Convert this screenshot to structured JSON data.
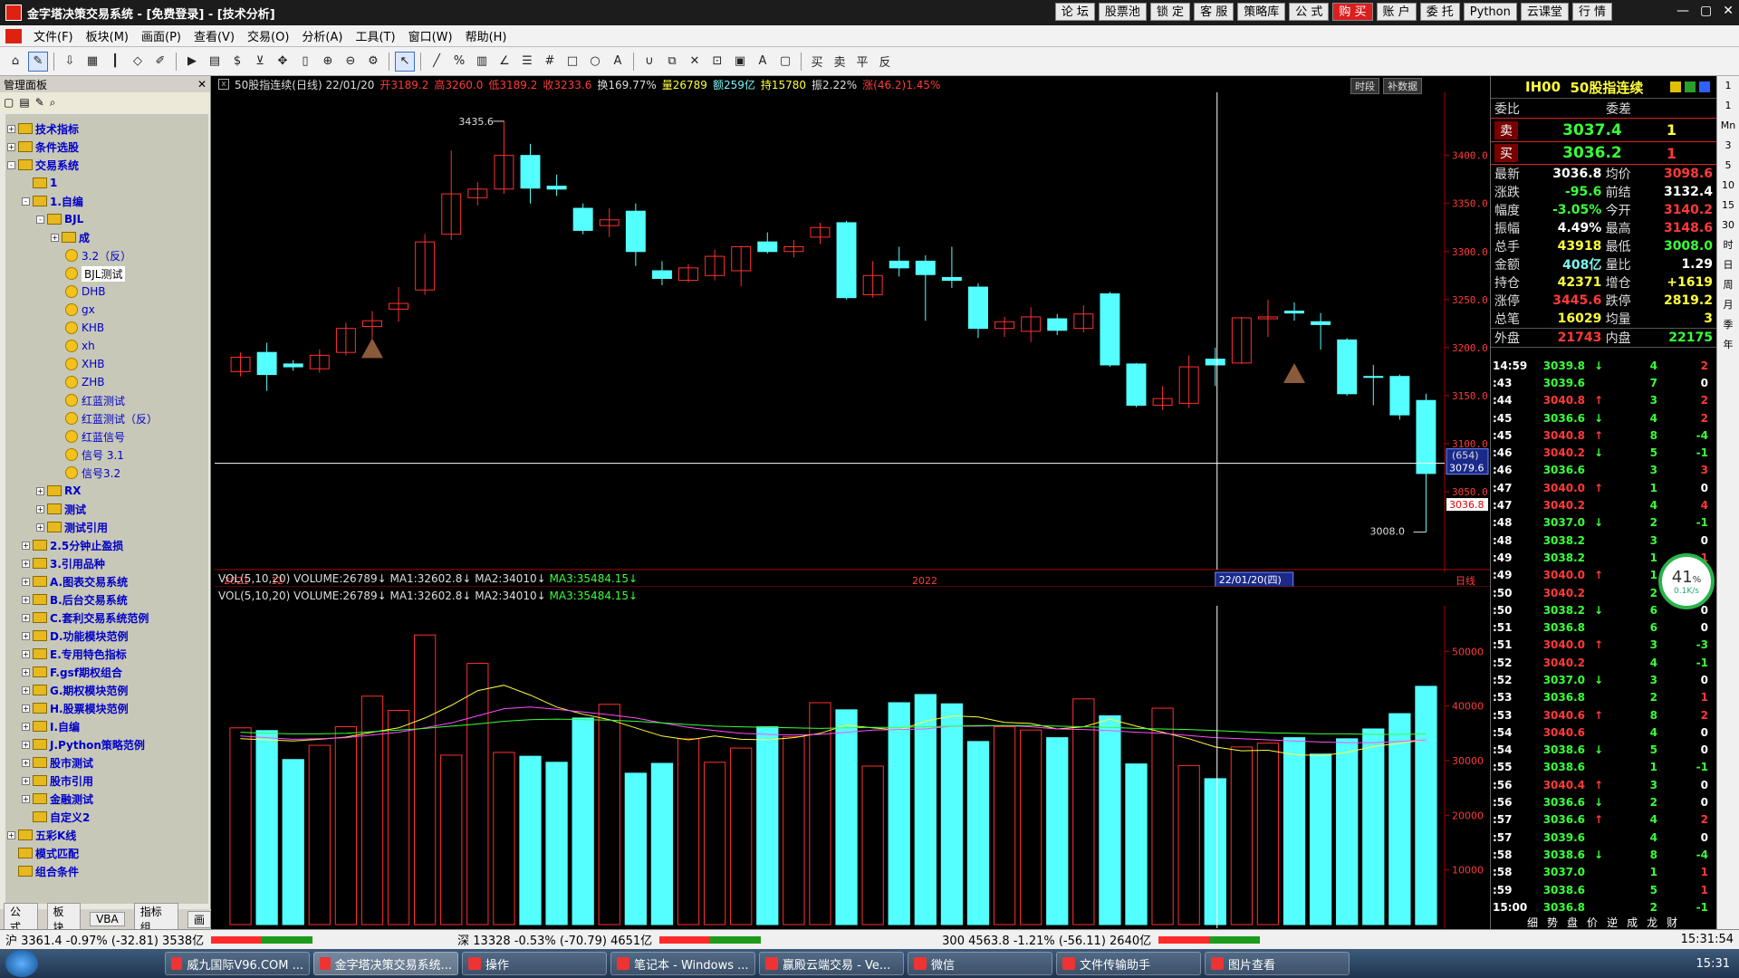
{
  "window": {
    "title": "金字塔决策交易系统 - [免费登录] - [技术分析]",
    "topbuttons": [
      "论 坛",
      "股票池",
      "锁 定",
      "客 服",
      "策略库",
      "公 式",
      "购 买",
      "账 户",
      "委 托",
      "Python",
      "云课堂",
      "行 情"
    ],
    "controls": [
      "—",
      "▢",
      "✕"
    ]
  },
  "menu": [
    "文件(F)",
    "板块(M)",
    "画面(P)",
    "查看(V)",
    "交易(O)",
    "分析(A)",
    "工具(T)",
    "窗口(W)",
    "帮助(H)"
  ],
  "toolbar_icons": [
    "home-icon",
    "draw-icon",
    "download-icon",
    "grid-icon",
    "bars-icon",
    "diamond-icon",
    "edit-icon",
    "play-icon",
    "doc-icon",
    "dollar-icon",
    "filter-icon",
    "cross-icon",
    "ruler-icon",
    "zoom-in-icon",
    "zoom-out-icon",
    "gear-icon",
    "pointer-icon",
    "line-icon",
    "percent-icon",
    "table-icon",
    "angle-icon",
    "hbars-icon",
    "hash-icon",
    "rect-icon",
    "circle-icon",
    "text-icon",
    "magnet-icon",
    "copy-icon",
    "delete-icon",
    "lock-icon",
    "lock2-icon",
    "font-icon",
    "save-icon",
    "buy-icon",
    "sell-icon",
    "flat-icon",
    "reverse-icon"
  ],
  "sidebar": {
    "title": "管理面板",
    "tree": [
      {
        "level": 0,
        "type": "fold",
        "exp": "+",
        "label": "技术指标"
      },
      {
        "level": 0,
        "type": "fold",
        "exp": "+",
        "label": "条件选股"
      },
      {
        "level": 0,
        "type": "fold",
        "exp": "-",
        "label": "交易系统"
      },
      {
        "level": 1,
        "type": "fold",
        "exp": "",
        "label": "1"
      },
      {
        "level": 1,
        "type": "fold",
        "exp": "-",
        "label": "1.自编"
      },
      {
        "level": 2,
        "type": "fold",
        "exp": "-",
        "label": "BJL"
      },
      {
        "level": 3,
        "type": "fold",
        "exp": "+",
        "label": "成"
      },
      {
        "level": 4,
        "type": "smile",
        "label": "3.2（反）"
      },
      {
        "level": 4,
        "type": "smile",
        "label": "BJL测试",
        "hl": true
      },
      {
        "level": 4,
        "type": "smile",
        "label": "DHB"
      },
      {
        "level": 4,
        "type": "smile",
        "label": "gx"
      },
      {
        "level": 4,
        "type": "smile",
        "label": "KHB"
      },
      {
        "level": 4,
        "type": "smile",
        "label": "xh"
      },
      {
        "level": 4,
        "type": "smile",
        "label": "XHB"
      },
      {
        "level": 4,
        "type": "smile",
        "label": "ZHB"
      },
      {
        "level": 4,
        "type": "smile",
        "label": "红蓝测试"
      },
      {
        "level": 4,
        "type": "smile",
        "label": "红蓝测试（反）"
      },
      {
        "level": 4,
        "type": "smile",
        "label": "红蓝信号"
      },
      {
        "level": 4,
        "type": "smile",
        "label": "信号 3.1"
      },
      {
        "level": 4,
        "type": "smile",
        "label": "信号3.2"
      },
      {
        "level": 2,
        "type": "fold",
        "exp": "+",
        "label": "RX"
      },
      {
        "level": 2,
        "type": "fold",
        "exp": "+",
        "label": "测试"
      },
      {
        "level": 2,
        "type": "fold",
        "exp": "+",
        "label": "测试引用"
      },
      {
        "level": 1,
        "type": "fold",
        "exp": "+",
        "label": "2.5分钟止盈损"
      },
      {
        "level": 1,
        "type": "fold",
        "exp": "+",
        "label": "3.引用品种"
      },
      {
        "level": 1,
        "type": "fold",
        "exp": "+",
        "label": "A.图表交易系统"
      },
      {
        "level": 1,
        "type": "fold",
        "exp": "+",
        "label": "B.后台交易系统"
      },
      {
        "level": 1,
        "type": "fold",
        "exp": "+",
        "label": "C.套利交易系统范例"
      },
      {
        "level": 1,
        "type": "fold",
        "exp": "+",
        "label": "D.功能模块范例"
      },
      {
        "level": 1,
        "type": "fold",
        "exp": "+",
        "label": "E.专用特色指标"
      },
      {
        "level": 1,
        "type": "fold",
        "exp": "+",
        "label": "F.gsf期权组合"
      },
      {
        "level": 1,
        "type": "fold",
        "exp": "+",
        "label": "G.期权模块范例"
      },
      {
        "level": 1,
        "type": "fold",
        "exp": "+",
        "label": "H.股票模块范例"
      },
      {
        "level": 1,
        "type": "fold",
        "exp": "+",
        "label": "I.自编"
      },
      {
        "level": 1,
        "type": "fold",
        "exp": "+",
        "label": "J.Python策略范例"
      },
      {
        "level": 1,
        "type": "fold",
        "exp": "+",
        "label": "股市测试"
      },
      {
        "level": 1,
        "type": "fold",
        "exp": "+",
        "label": "股市引用"
      },
      {
        "level": 1,
        "type": "fold",
        "exp": "+",
        "label": "金融测试"
      },
      {
        "level": 1,
        "type": "fold",
        "exp": "",
        "label": "自定义2"
      },
      {
        "level": 0,
        "type": "fold",
        "exp": "+",
        "label": "五彩K线"
      },
      {
        "level": 0,
        "type": "fold",
        "exp": "",
        "label": "模式匹配"
      },
      {
        "level": 0,
        "type": "fold",
        "exp": "",
        "label": "组合条件"
      }
    ],
    "tabs": [
      "公式",
      "板块",
      "VBA",
      "指标组",
      "画"
    ]
  },
  "chart": {
    "header": {
      "name": "50股指连续(日线) 22/01/20",
      "open": "开3189.2",
      "high": "高3260.0",
      "low": "低3189.2",
      "close": "收3233.6",
      "turnover": "换169.77%",
      "vol": "量26789",
      "amount": "额259亿",
      "oi": "持15780",
      "amp": "振2.22%",
      "chg": "涨(46.2)1.45%",
      "btn1": "时段",
      "btn2": "补数据"
    },
    "vol_header": {
      "name": "VOL(5,10,20)",
      "volume": "VOLUME:26789",
      "ma1": "MA1:32602.8",
      "ma2": "MA2:34010",
      "ma3": "MA3:35484.15"
    },
    "crosshair": {
      "date_label": "22/01/20(四)",
      "price_label": "3079.6",
      "badge": "(654)",
      "last": "3036.8"
    },
    "x_labels": [
      "2021",
      "12",
      "2022",
      "日线"
    ],
    "annotations": {
      "high": "3435.6",
      "low": "3008.0"
    }
  },
  "chart_data": [
    {
      "type": "candlestick",
      "ylim": [
        2985,
        3460
      ],
      "yticks": [
        3050,
        3100,
        3150,
        3200,
        3250,
        3300,
        3350,
        3400
      ],
      "candles": [
        [
          3175,
          3190,
          3170,
          3195
        ],
        [
          3195,
          3172,
          3155,
          3205
        ],
        [
          3183,
          3180,
          3176,
          3187
        ],
        [
          3178,
          3192,
          3174,
          3198
        ],
        [
          3195,
          3220,
          3192,
          3226
        ],
        [
          3222,
          3228,
          3210,
          3238
        ],
        [
          3240,
          3246,
          3227,
          3263
        ],
        [
          3260,
          3310,
          3255,
          3318
        ],
        [
          3318,
          3360,
          3312,
          3405
        ],
        [
          3356,
          3365,
          3348,
          3372
        ],
        [
          3365,
          3400,
          3360,
          3436
        ],
        [
          3400,
          3366,
          3350,
          3412
        ],
        [
          3368,
          3365,
          3358,
          3380
        ],
        [
          3345,
          3322,
          3318,
          3350
        ],
        [
          3327,
          3333,
          3315,
          3345
        ],
        [
          3342,
          3300,
          3285,
          3350
        ],
        [
          3280,
          3272,
          3265,
          3290
        ],
        [
          3270,
          3283,
          3268,
          3287
        ],
        [
          3275,
          3295,
          3270,
          3302
        ],
        [
          3280,
          3305,
          3264,
          3306
        ],
        [
          3310,
          3300,
          3298,
          3320
        ],
        [
          3300,
          3305,
          3294,
          3312
        ],
        [
          3315,
          3325,
          3308,
          3330
        ],
        [
          3330,
          3252,
          3250,
          3332
        ],
        [
          3255,
          3275,
          3252,
          3290
        ],
        [
          3290,
          3283,
          3274,
          3305
        ],
        [
          3290,
          3276,
          3228,
          3296
        ],
        [
          3273,
          3270,
          3262,
          3305
        ],
        [
          3263,
          3220,
          3210,
          3267
        ],
        [
          3220,
          3227,
          3211,
          3232
        ],
        [
          3217,
          3232,
          3206,
          3242
        ],
        [
          3230,
          3218,
          3213,
          3235
        ],
        [
          3220,
          3235,
          3216,
          3244
        ],
        [
          3256,
          3182,
          3180,
          3258
        ],
        [
          3183,
          3140,
          3138,
          3184
        ],
        [
          3140,
          3147,
          3135,
          3160
        ],
        [
          3142,
          3180,
          3137,
          3192
        ],
        [
          3188,
          3182,
          3160,
          3200
        ],
        [
          3184,
          3231,
          3183,
          3232
        ],
        [
          3230,
          3232,
          3211,
          3250
        ],
        [
          3238,
          3236,
          3228,
          3247
        ],
        [
          3227,
          3224,
          3198,
          3236
        ],
        [
          3208,
          3152,
          3150,
          3210
        ],
        [
          3170,
          3169,
          3140,
          3182
        ],
        [
          3170,
          3130,
          3125,
          3172
        ],
        [
          3145,
          3069,
          3008,
          3152
        ]
      ]
    },
    {
      "type": "bar",
      "name": "VOL(5,10,20)",
      "ylim": [
        0,
        58000
      ],
      "yticks": [
        10000,
        20000,
        30000,
        40000,
        50000
      ],
      "values": [
        36000,
        35500,
        30200,
        32800,
        36200,
        41800,
        39200,
        53000,
        31000,
        47800,
        31500,
        30800,
        29700,
        37800,
        40300,
        27700,
        29500,
        34000,
        29700,
        32300,
        36200,
        34400,
        40600,
        39300,
        29000,
        40600,
        42100,
        40400,
        33500,
        36200,
        35600,
        34200,
        41300,
        38200,
        29400,
        39600,
        29100,
        26700,
        32500,
        33200,
        34200,
        31200,
        34000,
        35800,
        38600,
        43600
      ],
      "ma": [
        {
          "name": "MA1",
          "color": "#ffff3a",
          "values": [
            34000,
            33800,
            33600,
            33900,
            34300,
            35200,
            36000,
            37800,
            40100,
            42800,
            43800,
            42000,
            39800,
            38500,
            37500,
            36000,
            34500,
            33800,
            34500,
            33900,
            33800,
            34200,
            35000,
            36500,
            36000,
            35600,
            37200,
            38200,
            38000,
            37000,
            36800,
            35800,
            36200,
            37600,
            36300,
            35200,
            34000,
            32500,
            31800,
            31900,
            31100,
            30900,
            31500,
            32600,
            33200,
            33800
          ]
        },
        {
          "name": "MA2",
          "color": "#ff4cff",
          "values": [
            34500,
            34200,
            33900,
            34000,
            34200,
            34700,
            35200,
            36000,
            36900,
            38200,
            39500,
            39800,
            39400,
            38900,
            38400,
            37800,
            36900,
            36100,
            35500,
            35000,
            34800,
            34700,
            34800,
            35200,
            35600,
            35700,
            35800,
            36300,
            36300,
            36400,
            36200,
            35800,
            35700,
            35500,
            35200,
            35000,
            34600,
            34200,
            34000,
            33800,
            33600,
            33400,
            33300,
            33300,
            33500,
            33800
          ]
        },
        {
          "name": "MA3",
          "color": "#3aff3a",
          "values": [
            35200,
            35000,
            34900,
            34900,
            35000,
            35300,
            35600,
            35900,
            36300,
            36700,
            37200,
            37500,
            37600,
            37500,
            37400,
            37200,
            36900,
            36600,
            36300,
            36200,
            36100,
            36000,
            35900,
            36000,
            36100,
            36100,
            36200,
            36300,
            36400,
            36400,
            36400,
            36300,
            36200,
            36100,
            35900,
            35800,
            35700,
            35500,
            35300,
            35100,
            35000,
            34900,
            34900,
            34800,
            34800,
            34900
          ]
        }
      ]
    }
  ],
  "quote": {
    "code": "IH00",
    "name": "50股指连续",
    "webi": "委比",
    "weicha": "委差",
    "sell": {
      "label": "卖",
      "price": "3037.4",
      "qty": "1"
    },
    "buy": {
      "label": "买",
      "price": "3036.2",
      "qty": "1"
    },
    "rows": [
      [
        "最新",
        "3036.8",
        "均价",
        "3098.6"
      ],
      [
        "涨跌",
        "-95.6",
        "前结",
        "3132.4"
      ],
      [
        "幅度",
        "-3.05%",
        "今开",
        "3140.2"
      ],
      [
        "振幅",
        "4.49%",
        "最高",
        "3148.6"
      ],
      [
        "总手",
        "43918",
        "最低",
        "3008.0"
      ],
      [
        "金额",
        "408亿",
        "量比",
        "1.29"
      ],
      [
        "持仓",
        "42371",
        "增仓",
        "+1619"
      ],
      [
        "涨停",
        "3445.6",
        "跌停",
        "2819.2"
      ],
      [
        "总笔",
        "16029",
        "均量",
        "3"
      ]
    ],
    "outer": [
      "外盘",
      "21743",
      "内盘",
      "22175"
    ],
    "ticks": [
      [
        "14:59",
        "3039.8",
        "↓",
        "4",
        "2"
      ],
      [
        ":43",
        "3039.6",
        "",
        "7",
        "0"
      ],
      [
        ":44",
        "3040.8",
        "↑",
        "3",
        "2"
      ],
      [
        ":45",
        "3036.6",
        "↓",
        "4",
        "2"
      ],
      [
        ":45",
        "3040.8",
        "↑",
        "8",
        "-4"
      ],
      [
        ":46",
        "3040.2",
        "↓",
        "5",
        "-1"
      ],
      [
        ":46",
        "3036.6",
        "",
        "3",
        "3"
      ],
      [
        ":47",
        "3040.0",
        "↑",
        "1",
        "0"
      ],
      [
        ":47",
        "3040.2",
        "",
        "4",
        "4"
      ],
      [
        ":48",
        "3037.0",
        "↓",
        "2",
        "-1"
      ],
      [
        ":48",
        "3038.2",
        "",
        "3",
        "0"
      ],
      [
        ":49",
        "3038.2",
        "",
        "1",
        "1"
      ],
      [
        ":49",
        "3040.0",
        "↑",
        "1",
        "1"
      ],
      [
        ":50",
        "3040.2",
        "",
        "2",
        "1"
      ],
      [
        ":50",
        "3038.2",
        "↓",
        "6",
        "0"
      ],
      [
        ":51",
        "3036.8",
        "",
        "6",
        "0"
      ],
      [
        ":51",
        "3040.0",
        "↑",
        "3",
        "-3"
      ],
      [
        ":52",
        "3040.2",
        "",
        "4",
        "-1"
      ],
      [
        ":52",
        "3037.0",
        "↓",
        "3",
        "0"
      ],
      [
        ":53",
        "3036.8",
        "",
        "2",
        "1"
      ],
      [
        ":53",
        "3040.6",
        "↑",
        "8",
        "2"
      ],
      [
        ":54",
        "3040.6",
        "",
        "4",
        "0"
      ],
      [
        ":54",
        "3038.6",
        "↓",
        "5",
        "0"
      ],
      [
        ":55",
        "3038.6",
        "",
        "1",
        "-1"
      ],
      [
        ":56",
        "3040.4",
        "↑",
        "3",
        "0"
      ],
      [
        ":56",
        "3036.6",
        "↓",
        "2",
        "0"
      ],
      [
        ":57",
        "3036.6",
        "↑",
        "4",
        "2"
      ],
      [
        ":57",
        "3039.6",
        "",
        "4",
        "0"
      ],
      [
        ":58",
        "3038.6",
        "↓",
        "8",
        "-4"
      ],
      [
        ":58",
        "3037.0",
        "",
        "1",
        "1"
      ],
      [
        ":59",
        "3038.6",
        "",
        "5",
        "1"
      ],
      [
        "15:00",
        "3036.8",
        "",
        "2",
        "-1"
      ]
    ],
    "tabs": [
      "细",
      "势",
      "盘",
      "价",
      "逆",
      "成",
      "龙",
      "财"
    ],
    "gauge": {
      "pct": "41",
      "unit": "%",
      "speed": "0.1K/s"
    }
  },
  "right_toolbar": [
    "1",
    "1",
    "Mn",
    "3",
    "5",
    "10",
    "15",
    "30",
    "时",
    "日",
    "周",
    "月",
    "季",
    "年"
  ],
  "status": {
    "sh": "沪 3361.4 -0.97% (-32.81) 3538亿",
    "sz": "深 13328 -0.53% (-70.79) 4651亿",
    "hs300": "300 4563.8 -1.21% (-56.11) 2640亿",
    "time": "15:31:54"
  },
  "taskbar": {
    "tasks": [
      "威九国际V96.COM ...",
      "金字塔决策交易系统...",
      "操作",
      "笔记本 - Windows ...",
      "赢殿云端交易 - Ve...",
      "微信",
      "文件传输助手",
      "图片查看"
    ],
    "clock": "15:31"
  }
}
